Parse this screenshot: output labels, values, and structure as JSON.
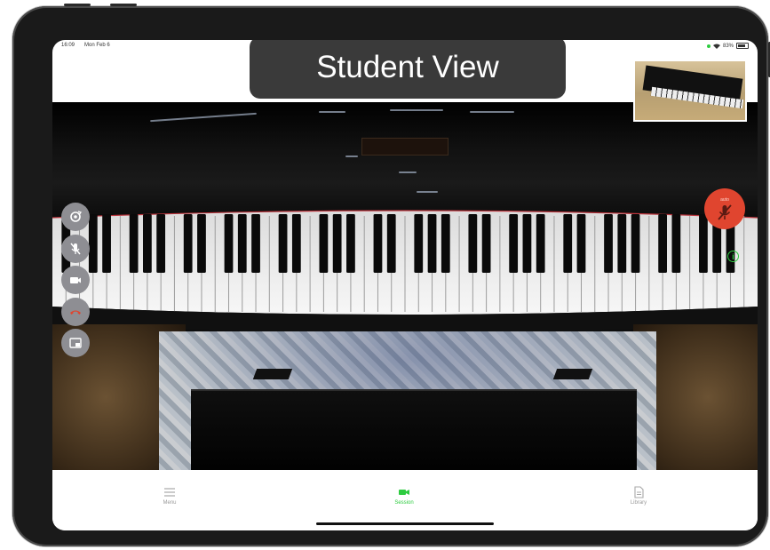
{
  "status_bar": {
    "time": "16:09",
    "date": "Mon Feb 6",
    "battery": "83%"
  },
  "title": "Student View",
  "mute_badge_label": "auto",
  "left_controls": [
    {
      "icon": "flip-camera-icon"
    },
    {
      "icon": "mic-off-icon"
    },
    {
      "icon": "video-camera-icon"
    },
    {
      "icon": "end-call-icon"
    },
    {
      "icon": "picture-in-picture-icon"
    }
  ],
  "tabs": [
    {
      "label": "Menu",
      "icon": "list-icon",
      "active": false
    },
    {
      "label": "Session",
      "icon": "video-camera-icon",
      "active": true
    },
    {
      "label": "Library",
      "icon": "document-icon",
      "active": false
    }
  ],
  "colors": {
    "accent": "#2ecc40",
    "mute_red": "#e0452f",
    "control_grey": "#8e8e93",
    "title_pill": "#3a3a3a"
  }
}
